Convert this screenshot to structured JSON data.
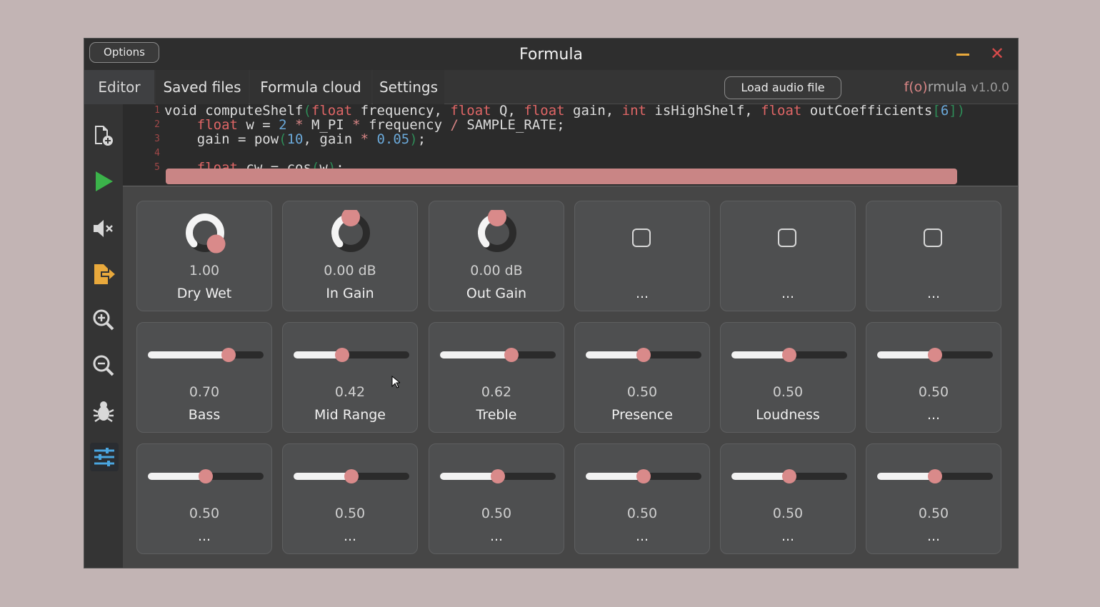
{
  "window": {
    "options_label": "Options",
    "title": "Formula",
    "minimize_color": "#e9a93c",
    "close_color": "#d94b4b"
  },
  "tabs": [
    {
      "label": "Editor",
      "active": true
    },
    {
      "label": "Saved files",
      "active": false
    },
    {
      "label": "Formula cloud",
      "active": false
    },
    {
      "label": "Settings",
      "active": false
    }
  ],
  "load_audio_label": "Load audio file",
  "brand": {
    "name_prefix": "f(o)",
    "name_suffix": "rmula",
    "version": "v1.0.0"
  },
  "sidebar_icons": [
    "new-file-icon",
    "play-icon",
    "mute-icon",
    "export-icon",
    "zoom-in-icon",
    "zoom-out-icon",
    "bug-icon",
    "sliders-icon"
  ],
  "code": {
    "line_numbers": [
      "1",
      "2",
      "3",
      "4",
      "5"
    ],
    "lines": [
      "void computeShelf(float frequency, float Q, float gain, int isHighShelf, float outCoefficients[6])",
      "    float w = 2 * M_PI * frequency / SAMPLE_RATE;",
      "    gain = pow(10, gain * 0.05);",
      "",
      "    float cw = cos(w);"
    ]
  },
  "knobs": [
    {
      "value": "1.00",
      "label": "Dry Wet",
      "level": 1.0
    },
    {
      "value": "0.00 dB",
      "label": "In Gain",
      "level": 0.5
    },
    {
      "value": "0.00 dB",
      "label": "Out Gain",
      "level": 0.5
    }
  ],
  "checkboxes": [
    {
      "label": "..."
    },
    {
      "label": "..."
    },
    {
      "label": "..."
    }
  ],
  "sliders": [
    {
      "value": "0.70",
      "label": "Bass",
      "level": 0.7
    },
    {
      "value": "0.42",
      "label": "Mid Range",
      "level": 0.42
    },
    {
      "value": "0.62",
      "label": "Treble",
      "level": 0.62
    },
    {
      "value": "0.50",
      "label": "Presence",
      "level": 0.5
    },
    {
      "value": "0.50",
      "label": "Loudness",
      "level": 0.5
    },
    {
      "value": "0.50",
      "label": "...",
      "level": 0.5
    },
    {
      "value": "0.50",
      "label": "...",
      "level": 0.5
    },
    {
      "value": "0.50",
      "label": "...",
      "level": 0.5
    },
    {
      "value": "0.50",
      "label": "...",
      "level": 0.5
    },
    {
      "value": "0.50",
      "label": "...",
      "level": 0.5
    },
    {
      "value": "0.50",
      "label": "...",
      "level": 0.5
    },
    {
      "value": "0.50",
      "label": "...",
      "level": 0.5
    }
  ],
  "accent_color": "#d98a8a"
}
